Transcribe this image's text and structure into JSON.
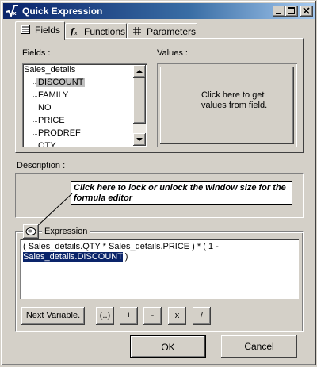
{
  "window": {
    "title": "Quick Expression",
    "controls": [
      "minimize",
      "maximize",
      "close"
    ]
  },
  "tabs": [
    {
      "label": "Fields",
      "icon": "fields-icon",
      "active": true
    },
    {
      "label": "Functions",
      "icon": "function-fx-icon",
      "active": false
    },
    {
      "label": "Parameters",
      "icon": "hash-icon",
      "active": false
    }
  ],
  "fields_panel": {
    "fields_label": "Fields :",
    "values_label": "Values :",
    "tree": {
      "root": "Sales_details",
      "children": [
        "DISCOUNT",
        "FAMILY",
        "NO",
        "PRICE",
        "PRODREF",
        "QTY"
      ],
      "selected": "DISCOUNT"
    },
    "values_button_text": "Click here to get values from field."
  },
  "description": {
    "label": "Description :",
    "tooltip": "Click here to lock or unlock the window size for the formula editor"
  },
  "expression": {
    "label": "Expression",
    "text_plain": "( Sales_details.QTY  *  Sales_details.PRICE ) * ( 1 -",
    "text_selected": "Sales_details.DISCOUNT",
    "text_after": " )"
  },
  "operator_buttons": [
    "Next Variable.",
    "(..)",
    "+",
    "-",
    "x",
    "/"
  ],
  "footer": {
    "ok_label": "OK",
    "cancel_label": "Cancel"
  },
  "colors": {
    "titlebar_start": "#0a246a",
    "titlebar_end": "#a6caf0",
    "selection": "#0a246a",
    "face": "#d4d0c8"
  }
}
